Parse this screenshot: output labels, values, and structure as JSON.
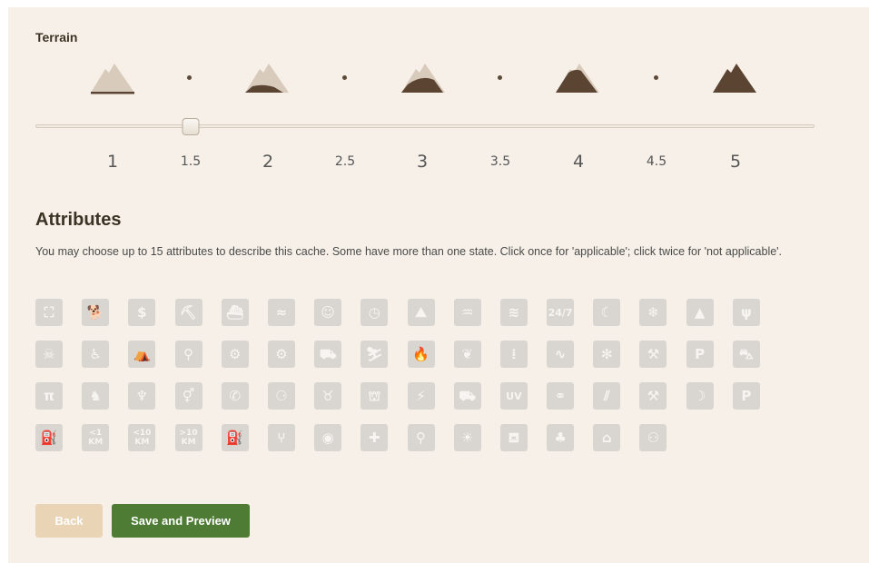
{
  "terrain": {
    "title": "Terrain",
    "selected_value": "1.5",
    "ticks": [
      {
        "label": "1",
        "major": true
      },
      {
        "label": "1.5",
        "major": false
      },
      {
        "label": "2",
        "major": true
      },
      {
        "label": "2.5",
        "major": false
      },
      {
        "label": "3",
        "major": true
      },
      {
        "label": "3.5",
        "major": false
      },
      {
        "label": "4",
        "major": true
      },
      {
        "label": "4.5",
        "major": false
      },
      {
        "label": "5",
        "major": true
      }
    ]
  },
  "attributes": {
    "title": "Attributes",
    "description": "You may choose up to 15 attributes to describe this cache. Some have more than one state. Click once for 'applicable'; click twice for 'not applicable'.",
    "icons": [
      {
        "name": "binoculars-icon",
        "glyph": "⛶"
      },
      {
        "name": "dogs-icon",
        "glyph": "🐕"
      },
      {
        "name": "fee-icon",
        "glyph": "$"
      },
      {
        "name": "climbing-gear-icon",
        "glyph": "⛏"
      },
      {
        "name": "boat-icon",
        "glyph": "⛴"
      },
      {
        "name": "scuba-icon",
        "glyph": "≈"
      },
      {
        "name": "kids-icon",
        "glyph": "☺"
      },
      {
        "name": "time-icon",
        "glyph": "◷"
      },
      {
        "name": "climbing-icon",
        "glyph": "⛰"
      },
      {
        "name": "wading-icon",
        "glyph": "♒"
      },
      {
        "name": "swimming-icon",
        "glyph": "≋"
      },
      {
        "name": "available-24-7-icon",
        "glyph": "24/7",
        "size": "small"
      },
      {
        "name": "night-icon",
        "glyph": "☾"
      },
      {
        "name": "winter-icon",
        "glyph": "❄"
      },
      {
        "name": "hazard-cliff-icon",
        "glyph": "▲"
      },
      {
        "name": "hunting-icon",
        "glyph": "ψ"
      },
      {
        "name": "poison-icon",
        "glyph": "☠"
      },
      {
        "name": "wheelchair-icon",
        "glyph": "♿"
      },
      {
        "name": "camping-icon",
        "glyph": "⛺"
      },
      {
        "name": "bicycles-icon",
        "glyph": "⚲"
      },
      {
        "name": "motorcycles-icon",
        "glyph": "⚙"
      },
      {
        "name": "quads-icon",
        "glyph": "⚙"
      },
      {
        "name": "offroad-icon",
        "glyph": "⛟"
      },
      {
        "name": "snowmobiles-icon",
        "glyph": "⛷"
      },
      {
        "name": "campfires-icon",
        "glyph": "🔥"
      },
      {
        "name": "thorns-icon",
        "glyph": "❦"
      },
      {
        "name": "stealth-icon",
        "glyph": "⁞"
      },
      {
        "name": "watch-snakes-icon",
        "glyph": "∿"
      },
      {
        "name": "ticks-icon",
        "glyph": "✻"
      },
      {
        "name": "abandoned-mines-icon",
        "glyph": "⚒"
      },
      {
        "name": "parking-icon",
        "glyph": "P"
      },
      {
        "name": "public-transit-icon",
        "glyph": "⛍"
      },
      {
        "name": "picnic-tables-icon",
        "glyph": "π"
      },
      {
        "name": "horses-icon",
        "glyph": "♞"
      },
      {
        "name": "drinking-water-icon",
        "glyph": "♆"
      },
      {
        "name": "restrooms-icon",
        "glyph": "⚥"
      },
      {
        "name": "telephone-icon",
        "glyph": "✆"
      },
      {
        "name": "stroller-icon",
        "glyph": "⚆"
      },
      {
        "name": "cow-icon",
        "glyph": "♉"
      },
      {
        "name": "field-puzzle-icon",
        "glyph": "⛫"
      },
      {
        "name": "flashlight-icon",
        "glyph": "⚡"
      },
      {
        "name": "rv-icon",
        "glyph": "⛟"
      },
      {
        "name": "uv-light-icon",
        "glyph": "UV",
        "size": "small"
      },
      {
        "name": "snowshoes-icon",
        "glyph": "⚭"
      },
      {
        "name": "skiing-icon",
        "glyph": "⫽"
      },
      {
        "name": "special-tool-icon",
        "glyph": "⚒"
      },
      {
        "name": "night-cache-icon",
        "glyph": "☽"
      },
      {
        "name": "parking-fee-icon",
        "glyph": "P"
      },
      {
        "name": "fuel-icon",
        "glyph": "⛽"
      },
      {
        "name": "short-hike-icon",
        "glyph": "<1 KM",
        "size": "tiny"
      },
      {
        "name": "medium-hike-icon",
        "glyph": "<10 KM",
        "size": "tiny"
      },
      {
        "name": "long-hike-icon",
        "glyph": ">10 KM",
        "size": "tiny"
      },
      {
        "name": "fuel-station-icon",
        "glyph": "⛽"
      },
      {
        "name": "food-icon",
        "glyph": "⑂"
      },
      {
        "name": "wireless-beacon-icon",
        "glyph": "◉"
      },
      {
        "name": "partnership-icon",
        "glyph": "✚"
      },
      {
        "name": "hiking-icon",
        "glyph": "⚲"
      },
      {
        "name": "seasonal-icon",
        "glyph": "☀"
      },
      {
        "name": "tourist-icon",
        "glyph": "⛾"
      },
      {
        "name": "tree-climbing-icon",
        "glyph": "♣"
      },
      {
        "name": "front-yard-icon",
        "glyph": "⌂"
      },
      {
        "name": "teamwork-icon",
        "glyph": "⚇"
      }
    ]
  },
  "buttons": {
    "back_label": "Back",
    "save_label": "Save and Preview"
  },
  "colors": {
    "panel_bg": "#f6f0e8",
    "mountain_light": "#d8cbbb",
    "mountain_dark": "#5b4532",
    "attr_icon_bg": "#d9d6d1",
    "back_button": "#e9d5b5",
    "save_button": "#4e7c34"
  }
}
